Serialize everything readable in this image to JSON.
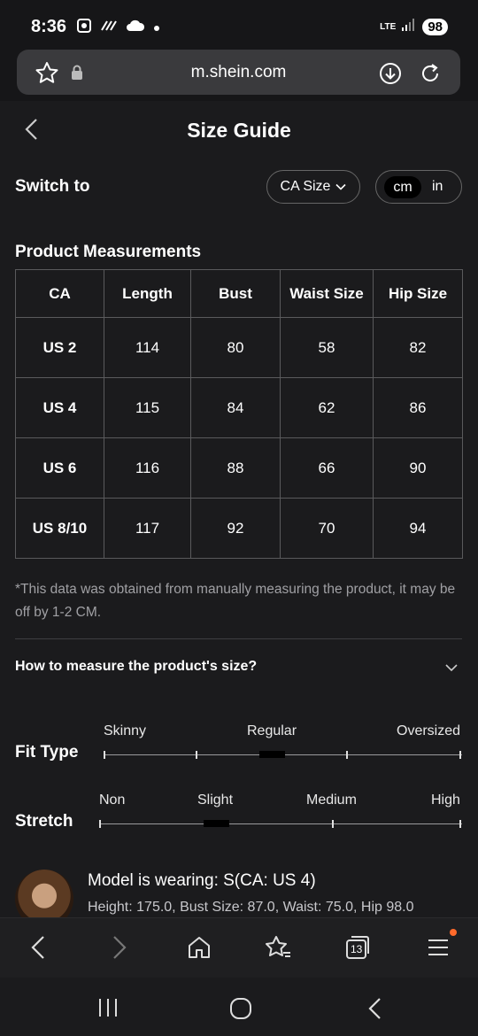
{
  "status": {
    "time": "8:36",
    "network": "LTE",
    "battery": "98"
  },
  "browser": {
    "url": "m.shein.com",
    "icons": [
      "star-icon",
      "lock-icon",
      "download-icon",
      "reload-icon"
    ]
  },
  "header": {
    "title": "Size Guide"
  },
  "switch": {
    "label": "Switch to",
    "size_system": "CA Size",
    "units": [
      "cm",
      "in"
    ],
    "active_unit": "cm"
  },
  "measurements": {
    "title": "Product Measurements",
    "columns": [
      "CA",
      "Length",
      "Bust",
      "Waist Size",
      "Hip Size"
    ],
    "rows": [
      [
        "US 2",
        "114",
        "80",
        "58",
        "82"
      ],
      [
        "US 4",
        "115",
        "84",
        "62",
        "86"
      ],
      [
        "US 6",
        "116",
        "88",
        "66",
        "90"
      ],
      [
        "US 8/10",
        "117",
        "92",
        "70",
        "94"
      ]
    ],
    "note": "*This data was obtained from manually measuring the product, it may be off by 1-2 CM."
  },
  "howto": {
    "label": "How to measure the product's size?"
  },
  "fit": {
    "label": "Fit Type",
    "scale": [
      "Skinny",
      "Regular",
      "Oversized"
    ],
    "selected": "Regular"
  },
  "stretch": {
    "label": "Stretch",
    "scale": [
      "Non",
      "Slight",
      "Medium",
      "High"
    ],
    "selected": "Slight"
  },
  "model": {
    "title": "Model is wearing: S(CA: US 4)",
    "detail": "Height: 175.0, Bust Size: 87.0, Waist: 75.0, Hip 98.0"
  },
  "bottom_nav": {
    "tab_count": "13",
    "accent": "#ff6a2b"
  }
}
